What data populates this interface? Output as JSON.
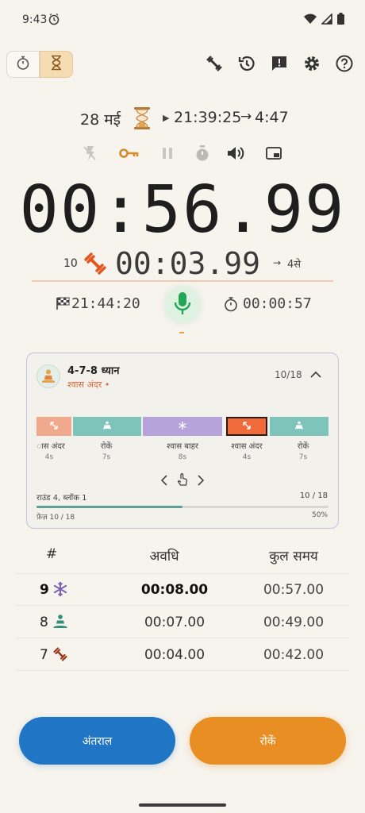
{
  "status": {
    "time": "9:43"
  },
  "header": {
    "date": "28 मई",
    "start_time": "21:39:25",
    "arrow": "→",
    "remaining": "4:47"
  },
  "main_timer": "00:56.99",
  "sub": {
    "count": "10",
    "time": "00:03.99",
    "next_arrow": "→",
    "next": "4से"
  },
  "info": {
    "end_time": "21:44:20",
    "elapsed": "00:00:57"
  },
  "card": {
    "title": "4-7-8 ध्यान",
    "subtitle": "श्वास अंदर •",
    "count": "10/18",
    "segments": [
      {
        "label": "ास अंदर",
        "dur": "4s",
        "color": "#f0a98d",
        "icon": "expand-icon"
      },
      {
        "label": "रोकें",
        "dur": "7s",
        "color": "#7fc4bb",
        "icon": "meditate-icon"
      },
      {
        "label": "श्वास बाहर",
        "dur": "8s",
        "color": "#b6a3d9",
        "icon": "snowflake-icon"
      },
      {
        "label": "श्वास अंदर",
        "dur": "4s",
        "color": "#f06a3a",
        "icon": "expand-icon"
      },
      {
        "label": "रोकें",
        "dur": "7s",
        "color": "#7fc4bb",
        "icon": "meditate-icon"
      }
    ],
    "round_label": "राउंड 4, ब्लॉक 1",
    "round_count": "10 / 18",
    "phase_label": "फ़ेज़ 10 / 18",
    "phase_pct": "50%",
    "progress": 0.5
  },
  "table": {
    "headers": [
      "#",
      "अवधि",
      "कुल समय"
    ],
    "rows": [
      {
        "num": "9",
        "icon": "snowflake-icon",
        "dur": "00:08.00",
        "total": "00:57.00"
      },
      {
        "num": "8",
        "icon": "meditate-icon",
        "dur": "00:07.00",
        "total": "00:49.00"
      },
      {
        "num": "7",
        "icon": "dumbbell-icon",
        "dur": "00:04.00",
        "total": "00:42.00"
      }
    ]
  },
  "buttons": {
    "interval": "अंतराल",
    "stop": "रोकें"
  },
  "colors": {
    "accent_orange": "#e88e22",
    "accent_blue": "#2076c5",
    "teal": "#7fc4bb",
    "purple": "#b6a3d9",
    "coral": "#f06a3a"
  }
}
